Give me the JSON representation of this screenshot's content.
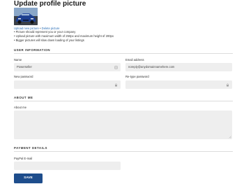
{
  "profile_picture": {
    "title": "Update profile picture",
    "upload_link": "Upload new picture",
    "separator": "•",
    "delete_link": "Delete picture",
    "guidelines": [
      "• Picture should represent you or your company",
      "• Upload picture with maximum width of 250px and maximum height of 200px",
      "• Bigger pictures will slow down loading of your listings"
    ]
  },
  "user_information": {
    "section_title": "USER INFORMATION",
    "name_label": "Name",
    "name_value": "Powerseller",
    "email_label": "Email address",
    "email_value": "noreply@anydomainnamehere.com",
    "new_password_label": "New password",
    "new_password_value": "",
    "retype_password_label": "Re-type password",
    "retype_password_value": ""
  },
  "about_me": {
    "section_title": "ABOUT ME",
    "about_label": "About me",
    "about_value": ""
  },
  "payment_details": {
    "section_title": "PAYMENT DETAILS",
    "paypal_label": "PayPal E-mail",
    "paypal_value": ""
  },
  "actions": {
    "save_label": "SAVE"
  },
  "colors": {
    "accent": "#1e4d8c",
    "link": "#2a6db5",
    "field_bg": "#eeeeee"
  },
  "icons": {
    "field_icon": "key-icon",
    "password_icon": "lock-icon",
    "resize_icon": "resize-grip-icon"
  }
}
